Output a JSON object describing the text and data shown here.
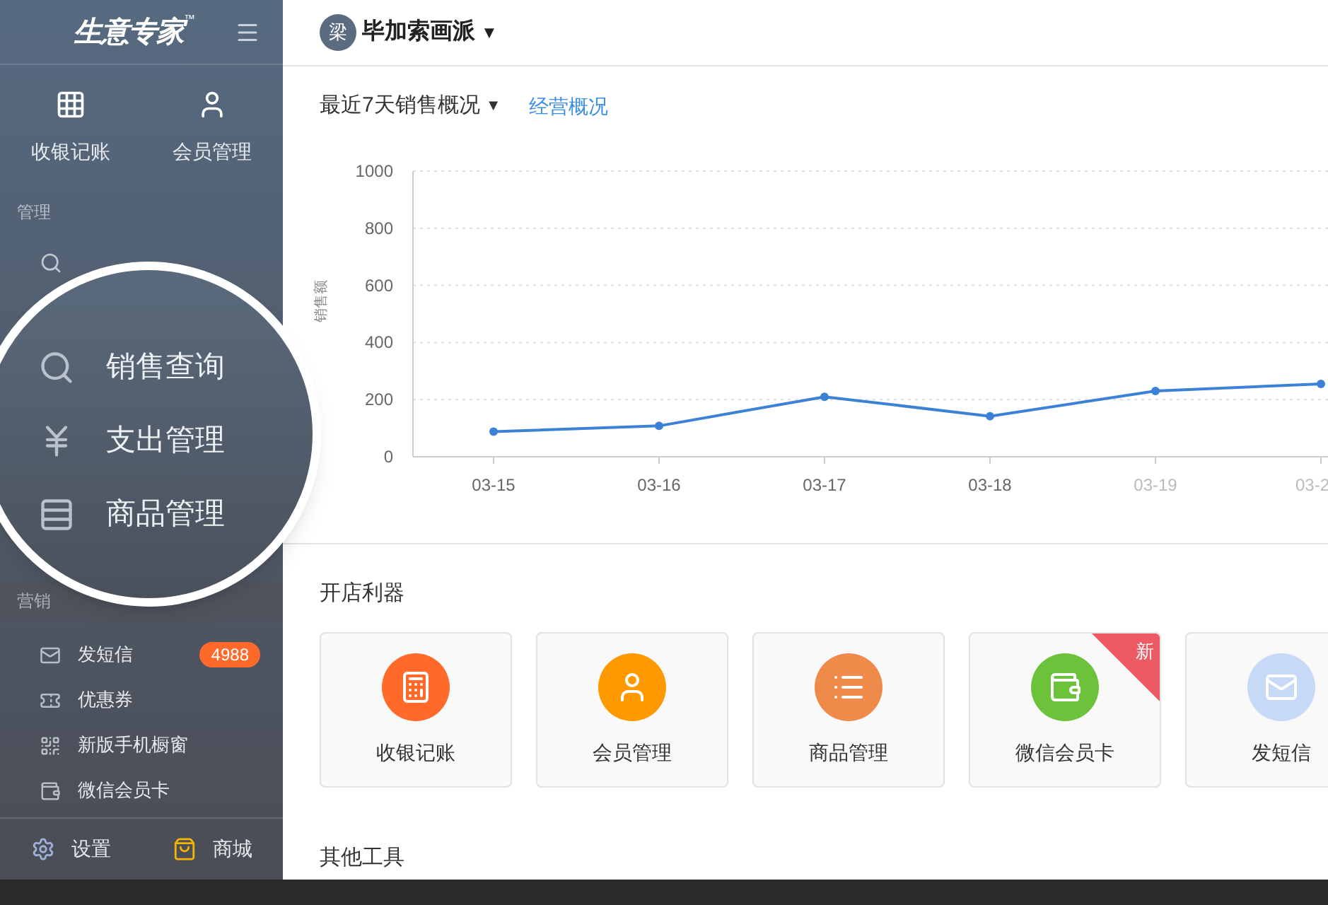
{
  "sidebar": {
    "logo": "生意专家",
    "logo_mark": "™",
    "quick_actions": [
      {
        "kind": "table",
        "label": "收银记账"
      },
      {
        "kind": "person",
        "label": "会员管理"
      }
    ],
    "manage": {
      "title": "管理"
    },
    "magnifier": {
      "items": [
        {
          "kind": "search",
          "label": "销售查询"
        },
        {
          "kind": "yen",
          "label": "支出管理"
        },
        {
          "kind": "goods",
          "label": "商品管理"
        }
      ]
    },
    "marketing": {
      "title": "营销",
      "items": [
        {
          "kind": "mail",
          "label": "发短信",
          "badge": "4988"
        },
        {
          "kind": "coupon",
          "label": "优惠券"
        },
        {
          "kind": "qr",
          "label": "新版手机橱窗"
        },
        {
          "kind": "card",
          "label": "微信会员卡"
        }
      ]
    },
    "footer": [
      {
        "kind": "gear",
        "label": "设置"
      },
      {
        "kind": "shop",
        "label": "商城"
      }
    ]
  },
  "header": {
    "avatar": "梁",
    "store": "毕加索画派",
    "caret": "▼"
  },
  "sales": {
    "title": "最近7天销售概况",
    "caret": "▼",
    "link": "经营概况",
    "chart_data": {
      "type": "line",
      "ylabel": "销售额",
      "categories": [
        "03-15",
        "03-16",
        "03-17",
        "03-18",
        "03-19",
        "03-2"
      ],
      "series": [
        {
          "color": "#3b82d6",
          "marker": "circle",
          "values": [
            88,
            108,
            210,
            142,
            230,
            255
          ]
        }
      ],
      "grid": true,
      "ylim": [
        0,
        1000
      ],
      "yticks": [
        0,
        200,
        400,
        600,
        800,
        1000
      ]
    }
  },
  "tools": {
    "title": "开店利器",
    "cards": [
      {
        "kind": "calculator",
        "label": "收银记账",
        "color": "#ff6a2b",
        "new": false
      },
      {
        "kind": "person",
        "label": "会员管理",
        "color": "#ff9900",
        "new": false
      },
      {
        "kind": "list",
        "label": "商品管理",
        "color": "#f08a4b",
        "new": false
      },
      {
        "kind": "wallet",
        "label": "微信会员卡",
        "color": "#6cc33b",
        "new": true,
        "new_label": "新"
      },
      {
        "kind": "mail",
        "label": "发短信",
        "color": "#c6daf7",
        "new": false
      }
    ]
  },
  "other": {
    "title": "其他工具"
  }
}
